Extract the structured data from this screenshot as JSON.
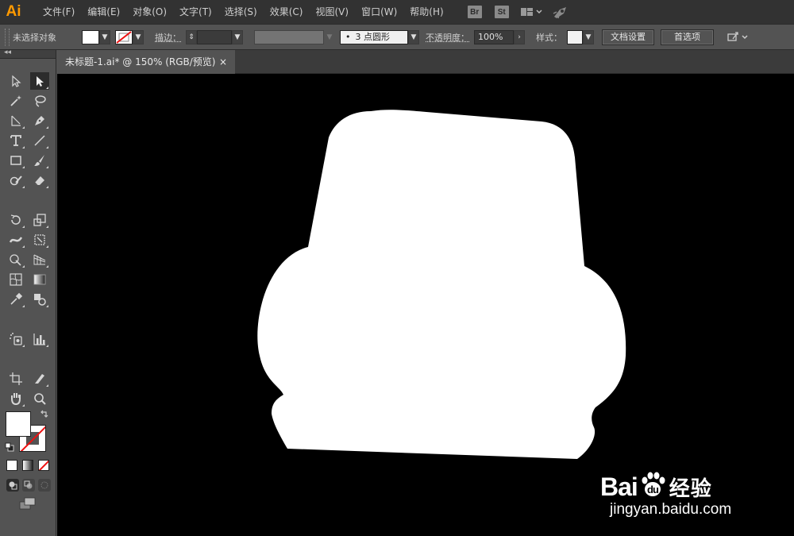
{
  "app": {
    "logo": "Ai",
    "brand_color": "#ff9a00"
  },
  "menu": [
    {
      "label": "文件(F)"
    },
    {
      "label": "编辑(E)"
    },
    {
      "label": "对象(O)"
    },
    {
      "label": "文字(T)"
    },
    {
      "label": "选择(S)"
    },
    {
      "label": "效果(C)"
    },
    {
      "label": "视图(V)"
    },
    {
      "label": "窗口(W)"
    },
    {
      "label": "帮助(H)"
    }
  ],
  "app_buttons": {
    "bridge": "Br",
    "stock": "St"
  },
  "control": {
    "selection_status": "未选择对象",
    "stroke_label": "描边：",
    "stroke_weight": "",
    "brush_dot": "•",
    "brush_label": "3 点圆形",
    "opacity_label": "不透明度：",
    "opacity_value": "100%",
    "style_label": "样式：",
    "doc_setup_button": "文档设置",
    "preferences_button": "首选项"
  },
  "toolbar": {
    "collapse_glyph": "◂◂"
  },
  "document_tab": {
    "title": "未标题-1.ai* @ 150% (RGB/预览)",
    "close_glyph": "×"
  },
  "fill_color": "#ffffff",
  "stroke_color": "none",
  "watermark": {
    "brand": "Bai",
    "brand_suffix": "du",
    "product": "经验",
    "url": "jingyan.baidu.com"
  }
}
